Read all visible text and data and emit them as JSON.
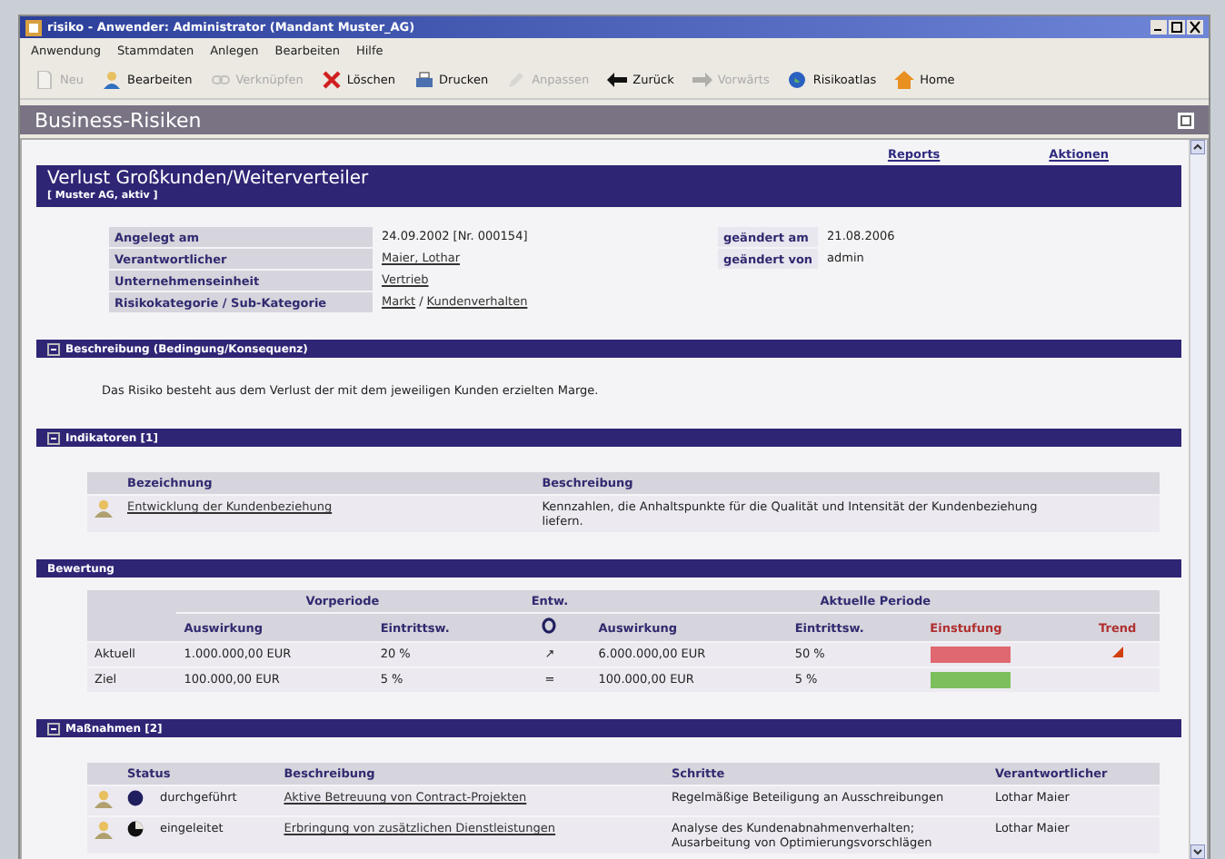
{
  "window": {
    "title": "risiko - Anwender: Administrator (Mandant Muster_AG)"
  },
  "menu": [
    "Anwendung",
    "Stammdaten",
    "Anlegen",
    "Bearbeiten",
    "Hilfe"
  ],
  "toolbar": [
    {
      "label": "Neu",
      "kind": "new",
      "disabled": true
    },
    {
      "label": "Bearbeiten",
      "kind": "edit",
      "disabled": false
    },
    {
      "label": "Verknüpfen",
      "kind": "link",
      "disabled": true
    },
    {
      "label": "Löschen",
      "kind": "delete",
      "disabled": false
    },
    {
      "label": "Drucken",
      "kind": "print",
      "disabled": false
    },
    {
      "label": "Anpassen",
      "kind": "adjust",
      "disabled": true
    },
    {
      "label": "Zurück",
      "kind": "back",
      "disabled": false
    },
    {
      "label": "Vorwärts",
      "kind": "forward",
      "disabled": true
    },
    {
      "label": "Risikoatlas",
      "kind": "globe",
      "disabled": false
    },
    {
      "label": "Home",
      "kind": "home",
      "disabled": false
    }
  ],
  "panel": {
    "title": "Business-Risiken",
    "links": [
      "Reports",
      "Aktionen"
    ]
  },
  "record": {
    "title": "Verlust Großkunden/Weiterverteiler",
    "subtitle": "[ Muster AG, aktiv ]",
    "fields": [
      {
        "label": "Angelegt am",
        "value": [
          {
            "text": "24.09.2002 [Nr. 000154]",
            "link": false
          }
        ]
      },
      {
        "label": "Verantwortlicher",
        "value": [
          {
            "text": "Maier, Lothar",
            "link": true
          }
        ]
      },
      {
        "label": "Unternehmenseinheit",
        "value": [
          {
            "text": "Vertrieb",
            "link": true
          }
        ]
      },
      {
        "label": "Risikokategorie / Sub-Kategorie",
        "value": [
          {
            "text": "Markt",
            "link": true
          },
          {
            "text": "/",
            "link": false
          },
          {
            "text": "Kundenverhalten",
            "link": true
          }
        ]
      }
    ],
    "side_fields": [
      {
        "label": "geändert am",
        "value": "21.08.2006"
      },
      {
        "label": "geändert von",
        "value": "admin"
      }
    ]
  },
  "description": {
    "title": "Beschreibung (Bedingung/Konsequenz)",
    "expanded": true,
    "text": "Das Risiko besteht aus dem Verlust der mit dem jeweiligen Kunden erzielten Marge."
  },
  "indicators": {
    "title": "Indikatoren [1]",
    "expanded": true,
    "columns": [
      "Bezeichnung",
      "Beschreibung"
    ],
    "rows": [
      {
        "name": "Entwicklung der Kundenbeziehung",
        "description": "Kennzahlen, die Anhaltspunkte für die Qualität und Intensität der Kundenbeziehung liefern."
      }
    ]
  },
  "rating": {
    "title": "Bewertung",
    "groups": [
      "Vorperiode",
      "Entw.",
      "Aktuelle Periode"
    ],
    "columns": [
      "Auswirkung",
      "Eintrittsw.",
      "Auswirkung",
      "Eintrittsw.",
      "Einstufung",
      "Trend"
    ],
    "rows": [
      {
        "label": "Aktuell",
        "prev_impact": "1.000.000,00 EUR",
        "prev_prob": "20 %",
        "change": "↗",
        "impact": "6.000.000,00 EUR",
        "prob": "50 %",
        "color": "#e06870",
        "trend": true
      },
      {
        "label": "Ziel",
        "prev_impact": "100.000,00 EUR",
        "prev_prob": "5 %",
        "change": "=",
        "impact": "100.000,00 EUR",
        "prob": "5 %",
        "color": "#7cbf5c",
        "trend": false
      }
    ]
  },
  "measures": {
    "title": "Maßnahmen [2]",
    "expanded": true,
    "columns": [
      "Status",
      "Beschreibung",
      "Schritte",
      "Verantwortlicher"
    ],
    "rows": [
      {
        "kind": "done",
        "status": "durchgeführt",
        "description": "Aktive Betreuung von Contract-Projekten",
        "steps": "Regelmäßige Beteiligung an Ausschreibungen",
        "owner": "Lothar Maier"
      },
      {
        "kind": "started",
        "status": "eingeleitet",
        "description": "Erbringung von zusätzlichen Dienstleistungen",
        "steps": "Analyse des Kundenabnahmenverhalten; Ausarbeitung von Optimierungsvorschlägen",
        "owner": "Lothar Maier"
      }
    ]
  }
}
